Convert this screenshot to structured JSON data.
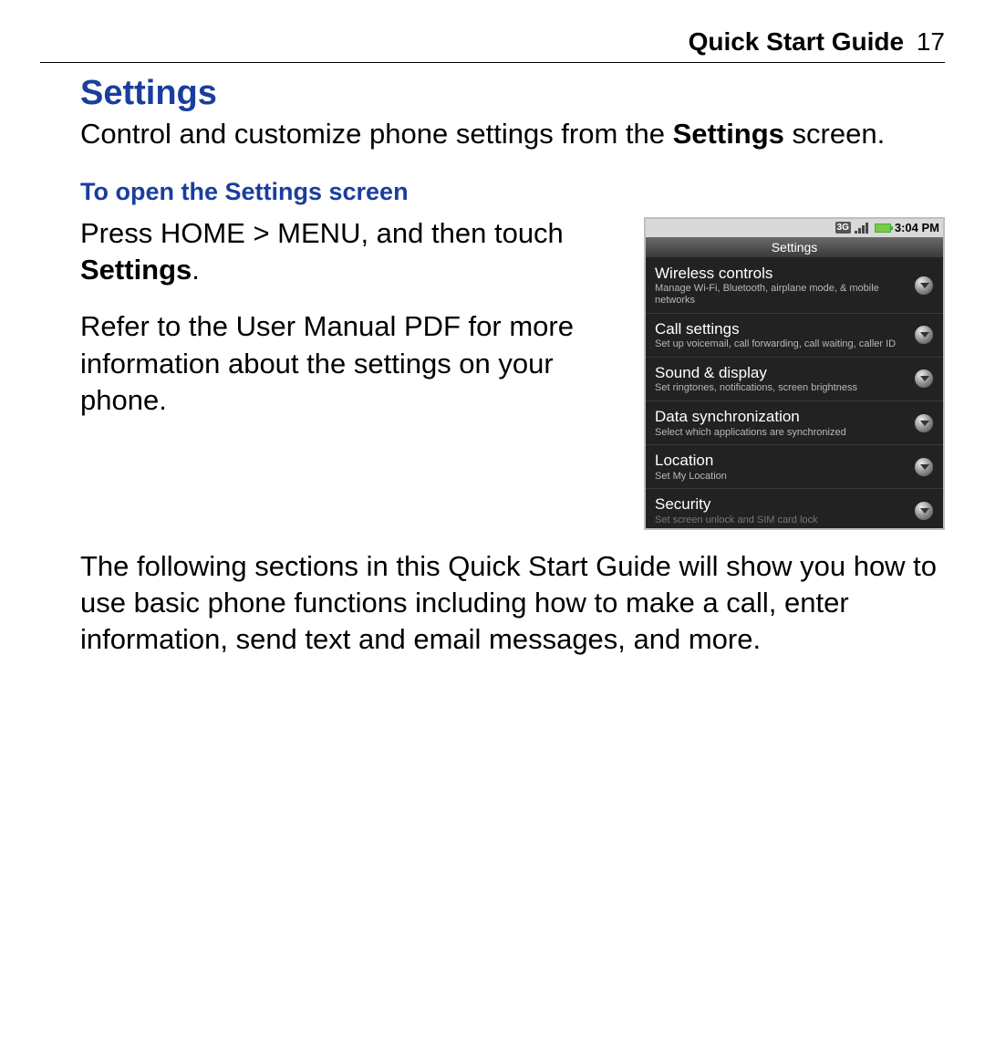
{
  "header": {
    "title": "Quick Start Guide",
    "page_number": "17"
  },
  "section": {
    "title": "Settings",
    "intro_before_bold": "Control and customize phone settings from the ",
    "intro_bold": "Settings",
    "intro_after_bold": " screen."
  },
  "subsection": {
    "title": "To open the Settings screen",
    "p1_before": "Press HOME > MENU, and then touch ",
    "p1_bold": "Settings",
    "p1_after": ".",
    "p2": "Refer to the User Manual PDF for more information about the settings on your phone."
  },
  "phone": {
    "status_time": "3:04 PM",
    "title": "Settings",
    "rows": [
      {
        "title": "Wireless controls",
        "desc": "Manage Wi-Fi, Bluetooth, airplane mode, & mobile networks"
      },
      {
        "title": "Call settings",
        "desc": "Set up voicemail, call forwarding, call waiting, caller ID"
      },
      {
        "title": "Sound & display",
        "desc": "Set ringtones, notifications, screen brightness"
      },
      {
        "title": "Data synchronization",
        "desc": "Select which applications are synchronized"
      },
      {
        "title": "Location",
        "desc": "Set My Location"
      },
      {
        "title": "Security",
        "desc": "Set screen unlock and SIM card lock"
      }
    ]
  },
  "closing": "The following sections in this Quick Start Guide will show you how to use basic phone functions including how to make a call, enter information, send text and email messages, and more."
}
